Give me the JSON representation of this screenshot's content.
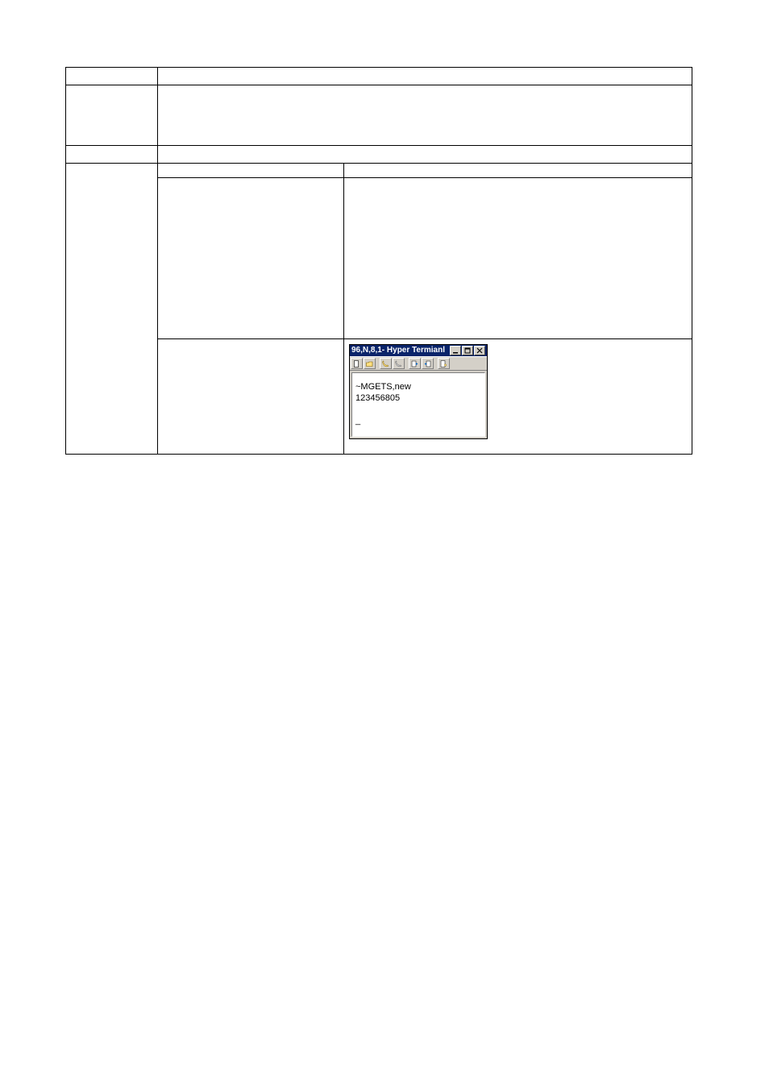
{
  "terminal": {
    "title": "96,N,8,1- Hyper Termianl",
    "controls": {
      "minimize": "minimize-icon",
      "maximize": "maximize-icon",
      "close": "close-icon"
    },
    "content": {
      "line1": "~MGETS,new",
      "line2": "123456805",
      "caret": "_"
    }
  }
}
